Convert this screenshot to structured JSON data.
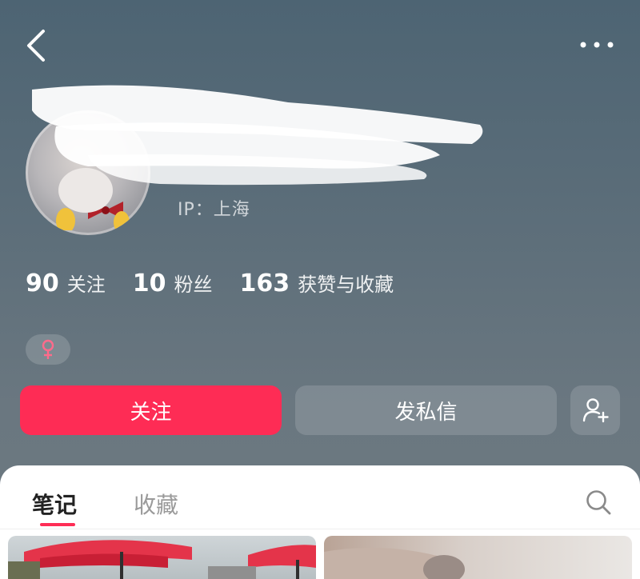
{
  "header": {
    "back_icon": "chevron-left-icon",
    "more_icon": "more-horizontal-icon"
  },
  "profile": {
    "ip_text": "IP：上海",
    "gender_icon": "female-icon",
    "gender_color": "#ff6b8b"
  },
  "stats": [
    {
      "number": "90",
      "label": "关注"
    },
    {
      "number": "10",
      "label": "粉丝"
    },
    {
      "number": "163",
      "label": "获赞与收藏"
    }
  ],
  "actions": {
    "follow_label": "关注",
    "message_label": "发私信",
    "add_friend_icon": "add-user-icon",
    "accent": "#fe2c55"
  },
  "tabs": [
    {
      "label": "笔记",
      "active": true
    },
    {
      "label": "收藏",
      "active": false
    }
  ],
  "search_icon": "search-icon"
}
